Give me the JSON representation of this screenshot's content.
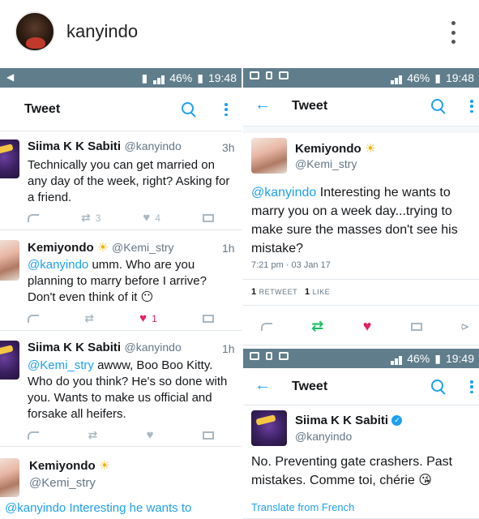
{
  "profile": {
    "username": "kanyindo"
  },
  "left": {
    "status": {
      "battery": "46%",
      "time": "19:48"
    },
    "title": "Tweet",
    "tweets": [
      {
        "name": "Siima K K Sabiti",
        "handle": "@kanyindo",
        "time": "3h",
        "text": "Technically you can get married on any day of the week, right? Asking for a friend.",
        "retweets": "3",
        "likes": "4"
      },
      {
        "name": "Kemiyondo",
        "handle": "@Kemi_stry",
        "time": "1h",
        "mention": "@kanyindo",
        "text": " umm. Who are you planning to marry before I arrive? Don't even think of it 😶",
        "likes": "1"
      },
      {
        "name": "Siima K K Sabiti",
        "handle": "@kanyindo",
        "time": "1h",
        "mention": "@Kemi_stry",
        "text": " awww, Boo Boo Kitty. Who do you think? He's so done with you. Wants to make us official and forsake all heifers."
      },
      {
        "name": "Kemiyondo",
        "handle": "@Kemi_stry",
        "partial": "@kanyindo Interesting he wants to"
      }
    ]
  },
  "right_top": {
    "status": {
      "battery": "46%",
      "time": "19:48"
    },
    "title": "Tweet",
    "tweet": {
      "name": "Kemiyondo",
      "handle": "@Kemi_stry",
      "mention": "@kanyindo",
      "text": " Interesting he wants to marry you on a week day...trying to make sure the masses don't see his mistake?",
      "timestamp": "7:21 pm · 03 Jan 17",
      "retweets_count": "1",
      "retweets_label": "RETWEET",
      "likes_count": "1",
      "likes_label": "LIKE"
    }
  },
  "right_bottom": {
    "status": {
      "battery": "46%",
      "time": "19:49"
    },
    "title": "Tweet",
    "tweet": {
      "name": "Siima K K Sabiti",
      "handle": "@kanyindo",
      "text": "No. Preventing gate crashers. Past mistakes. Comme toi, chérie 😘",
      "translate": "Translate from French"
    }
  }
}
